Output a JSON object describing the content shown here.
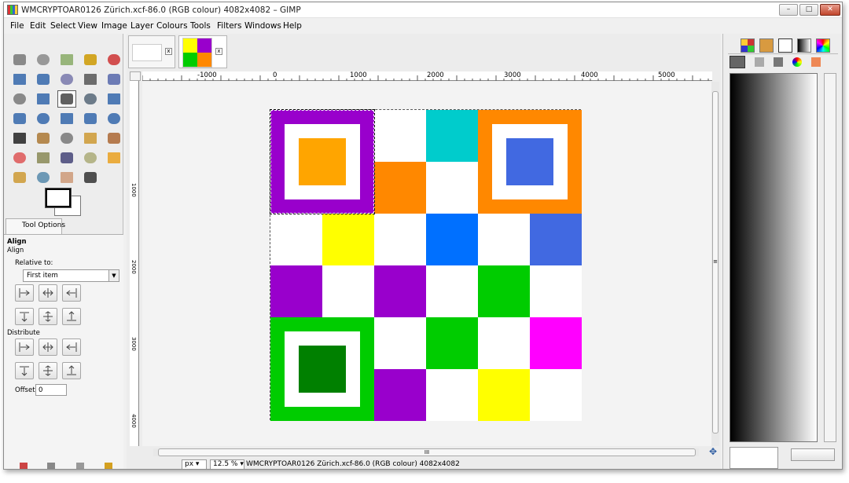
{
  "window": {
    "title": "WMCRYPTOAR0126 Zürich.xcf-86.0 (RGB colour) 4082x4082 – GIMP",
    "controls": {
      "minimize": "–",
      "maximize": "□",
      "close": "✕"
    }
  },
  "menubar": [
    {
      "label": "File"
    },
    {
      "label": "Edit"
    },
    {
      "label": "Select"
    },
    {
      "label": "View"
    },
    {
      "label": "Image"
    },
    {
      "label": "Layer"
    },
    {
      "label": "Colours"
    },
    {
      "label": "Tools"
    },
    {
      "label": "Filters"
    },
    {
      "label": "Windows"
    },
    {
      "label": "Help"
    }
  ],
  "tool_options": {
    "tab_label": "Tool Options",
    "heading": "Align",
    "subheading": "Align",
    "relative_to_label": "Relative to:",
    "relative_to_value": "First item",
    "distribute_label": "Distribute",
    "offset_label": "Offset:",
    "offset_value": "0"
  },
  "rulers": {
    "h_labels": [
      "-1000",
      "0",
      "1000",
      "2000",
      "3000",
      "4000",
      "5000"
    ],
    "v_labels": [
      "1000",
      "2000",
      "3000",
      "4000"
    ]
  },
  "image_grid": {
    "colors": {
      "purple": "#9900cc",
      "orange": "#ff8800",
      "lightorange": "#ffa500",
      "blue": "#4169e1",
      "cyan": "#00cccc",
      "yellow": "#ffff00",
      "azure": "#0070ff",
      "royal": "#4169e1",
      "green": "#00cc00",
      "darkgreen": "#008000",
      "magenta": "#ff00ff",
      "white": "#ffffff"
    },
    "cells": [
      [
        "finder",
        "finder",
        "white",
        "cyan",
        "finder",
        "finder"
      ],
      [
        "finder",
        "finder",
        "orange",
        "white",
        "finder",
        "finder"
      ],
      [
        "white",
        "yellow",
        "white",
        "azure",
        "white",
        "royal"
      ],
      [
        "purple",
        "white",
        "purple",
        "white",
        "green",
        "white"
      ],
      [
        "finder",
        "finder",
        "white",
        "green",
        "white",
        "magenta"
      ],
      [
        "finder",
        "finder",
        "purple",
        "white",
        "yellow",
        "white"
      ]
    ],
    "finders": [
      {
        "corner": "top-left",
        "outer": "purple",
        "inner": "lightorange"
      },
      {
        "corner": "top-right",
        "outer": "orange",
        "inner": "blue"
      },
      {
        "corner": "bottom-left",
        "outer": "green",
        "inner": "darkgreen"
      }
    ]
  },
  "status": {
    "unit": "px",
    "zoom": "12.5 %",
    "text": "WMCRYPTOAR0126 Zürich.xcf-86.0 (RGB colour) 4082x4082"
  },
  "hscroll_center": "III",
  "vscroll_center": "≡"
}
